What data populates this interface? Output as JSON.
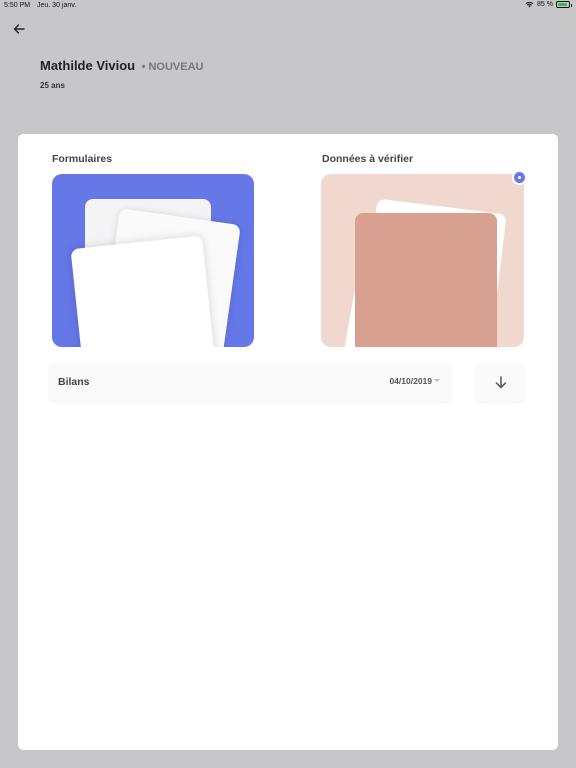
{
  "status_bar": {
    "time": "5:50 PM",
    "date": "Jeu. 30 janv.",
    "battery": "85 %"
  },
  "patient": {
    "name": "Mathilde Viviou",
    "badge": "• NOUVEAU",
    "age": "25 ans"
  },
  "tiles": {
    "forms": {
      "label": "Formulaires",
      "color": "#6677e8"
    },
    "verify": {
      "label": "Données à vérifier",
      "color": "#f0d8cf",
      "accent": "#d8a090"
    }
  },
  "bilans": {
    "label": "Bilans",
    "selected_date": "04/10/2019"
  },
  "icons": {
    "back": "arrow-left-icon",
    "download": "arrow-down-icon",
    "wifi": "wifi-icon",
    "battery": "battery-icon",
    "dropdown": "caret-down-icon",
    "notification": "notification-dot-icon"
  },
  "colors": {
    "background": "#c7c7c9",
    "card": "#ffffff",
    "accent": "#6677e8"
  }
}
